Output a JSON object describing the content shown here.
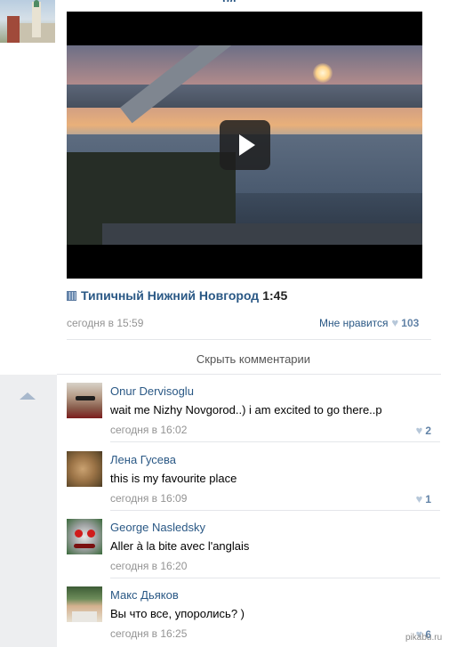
{
  "post": {
    "header_fragment": "рд",
    "video": {
      "title": "Типичный Нижний Новгород",
      "duration": "1:45"
    },
    "date": "сегодня в 15:59",
    "like_label": "Мне нравится",
    "like_count": "103",
    "hide_comments": "Скрыть комментарии"
  },
  "comments": [
    {
      "author": "Onur Dervisoglu",
      "text": "wait me Nizhy Novgorod..) i am excited to go there..p",
      "date": "сегодня в 16:02",
      "likes": "2"
    },
    {
      "author": "Лена Гусева",
      "text": "this is my favourite place",
      "date": "сегодня в 16:09",
      "likes": "1"
    },
    {
      "author": "George Nasledsky",
      "text": "Aller à la bite avec l'anglais",
      "date": "сегодня в 16:20",
      "likes": ""
    },
    {
      "author": "Макс Дьяков",
      "text": "Вы что все, упоролись? )",
      "date": "сегодня в 16:25",
      "likes": "6"
    }
  ],
  "watermark": "pikabu.ru",
  "icons": {
    "play": "play-icon",
    "video": "video-icon",
    "heart": "heart-icon",
    "collapse": "chevron-up-icon"
  },
  "colors": {
    "link": "#2a5885",
    "meta": "#939393",
    "like_count": "#6283a7",
    "gutter": "#edeef0"
  }
}
